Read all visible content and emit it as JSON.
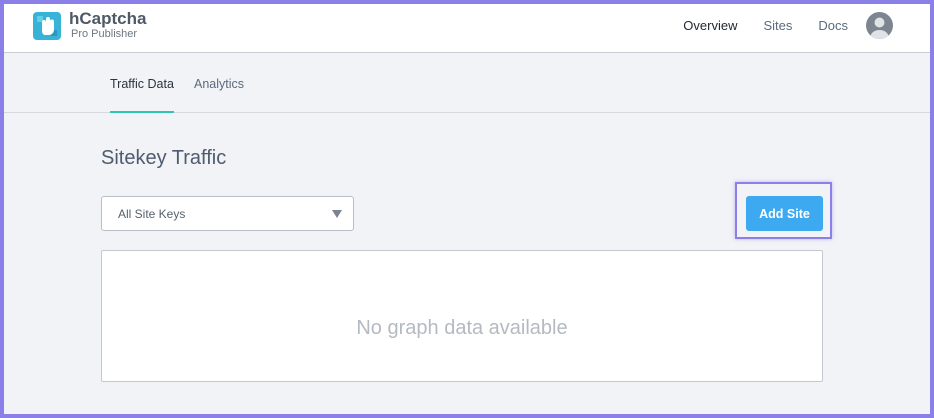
{
  "brand": {
    "name": "hCaptcha",
    "subtitle": "Pro Publisher"
  },
  "nav": {
    "items": [
      "Overview",
      "Sites",
      "Docs"
    ],
    "active": "Overview"
  },
  "tabs": {
    "items": [
      "Traffic Data",
      "Analytics"
    ],
    "active": "Traffic Data"
  },
  "main": {
    "title": "Sitekey Traffic",
    "select_value": "All Site Keys",
    "add_button": "Add Site",
    "graph_empty": "No graph data available"
  },
  "colors": {
    "accent": "#3da9f0",
    "tab_underline": "#2ec4b6",
    "highlight": "#8b80e8"
  },
  "icons": {
    "logo": "hand-logo-icon",
    "avatar": "user-avatar-icon",
    "caret": "caret-down-icon"
  }
}
